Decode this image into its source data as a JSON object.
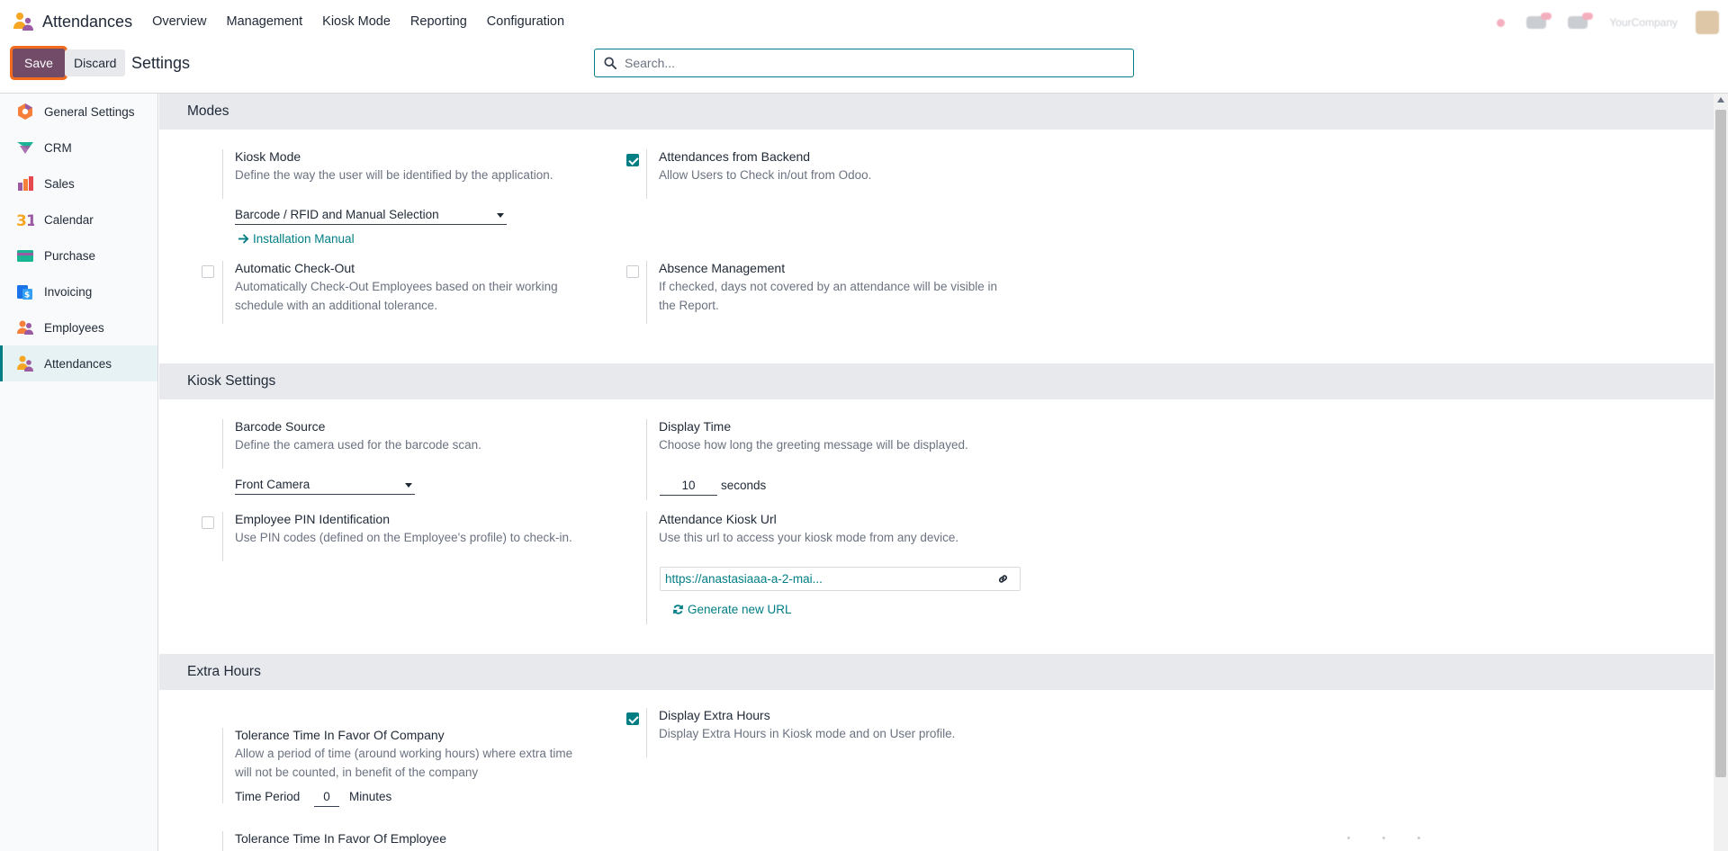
{
  "navbar": {
    "app_name": "Attendances",
    "menu": [
      "Overview",
      "Management",
      "Kiosk Mode",
      "Reporting",
      "Configuration"
    ],
    "company": "YourCompany"
  },
  "control": {
    "save_label": "Save",
    "discard_label": "Discard",
    "title": "Settings",
    "search_placeholder": "Search..."
  },
  "sidebar": {
    "items": [
      {
        "label": "General Settings",
        "icon": "general-settings-icon"
      },
      {
        "label": "CRM",
        "icon": "crm-icon"
      },
      {
        "label": "Sales",
        "icon": "sales-icon"
      },
      {
        "label": "Calendar",
        "icon": "calendar-icon"
      },
      {
        "label": "Purchase",
        "icon": "purchase-icon"
      },
      {
        "label": "Invoicing",
        "icon": "invoicing-icon"
      },
      {
        "label": "Employees",
        "icon": "employees-icon"
      },
      {
        "label": "Attendances",
        "icon": "attendances-icon",
        "active": true
      }
    ]
  },
  "modes": {
    "header": "Modes",
    "kiosk_mode": {
      "title": "Kiosk Mode",
      "desc": "Define the way the user will be identified by the application.",
      "value": "Barcode / RFID and Manual Selection",
      "link": "Installation Manual"
    },
    "backend": {
      "title": "Attendances from Backend",
      "desc": "Allow Users to Check in/out from Odoo.",
      "checked": true
    },
    "auto_checkout": {
      "title": "Automatic Check-Out",
      "desc_line1": "Automatically Check-Out Employees based on their working",
      "desc_line2": "schedule with an additional tolerance.",
      "checked": false
    },
    "absence": {
      "title": "Absence Management",
      "desc_line1": "If checked, days not covered by an attendance will be visible in",
      "desc_line2": "the Report.",
      "checked": false
    }
  },
  "kiosk": {
    "header": "Kiosk Settings",
    "barcode_source": {
      "title": "Barcode Source",
      "desc": "Define the camera used for the barcode scan.",
      "value": "Front Camera"
    },
    "display_time": {
      "title": "Display Time",
      "desc": "Choose how long the greeting message will be displayed.",
      "value": "10",
      "unit": "seconds"
    },
    "pin": {
      "title": "Employee PIN Identification",
      "desc": "Use PIN codes (defined on the Employee's profile) to check-in.",
      "checked": false
    },
    "kiosk_url": {
      "title": "Attendance Kiosk Url",
      "desc": "Use this url to access your kiosk mode from any device.",
      "url": "https://anastasiaaa-a-2-mai...",
      "generate": "Generate new URL"
    }
  },
  "extra": {
    "header": "Extra Hours",
    "tolerance_company": {
      "title": "Tolerance Time In Favor Of Company",
      "desc_line1": "Allow a period of time (around working hours) where extra time",
      "desc_line2": "will not be counted, in benefit of the company",
      "period_label": "Time Period",
      "period_value": "0",
      "period_unit": "Minutes"
    },
    "display_extra": {
      "title": "Display Extra Hours",
      "desc": "Display Extra Hours in Kiosk mode and on User profile.",
      "checked": true
    },
    "tolerance_employee": {
      "title": "Tolerance Time In Favor Of Employee"
    }
  },
  "colors": {
    "primary": "#714b67",
    "accent": "#017e84",
    "focus_outline": "#f26b1d"
  }
}
